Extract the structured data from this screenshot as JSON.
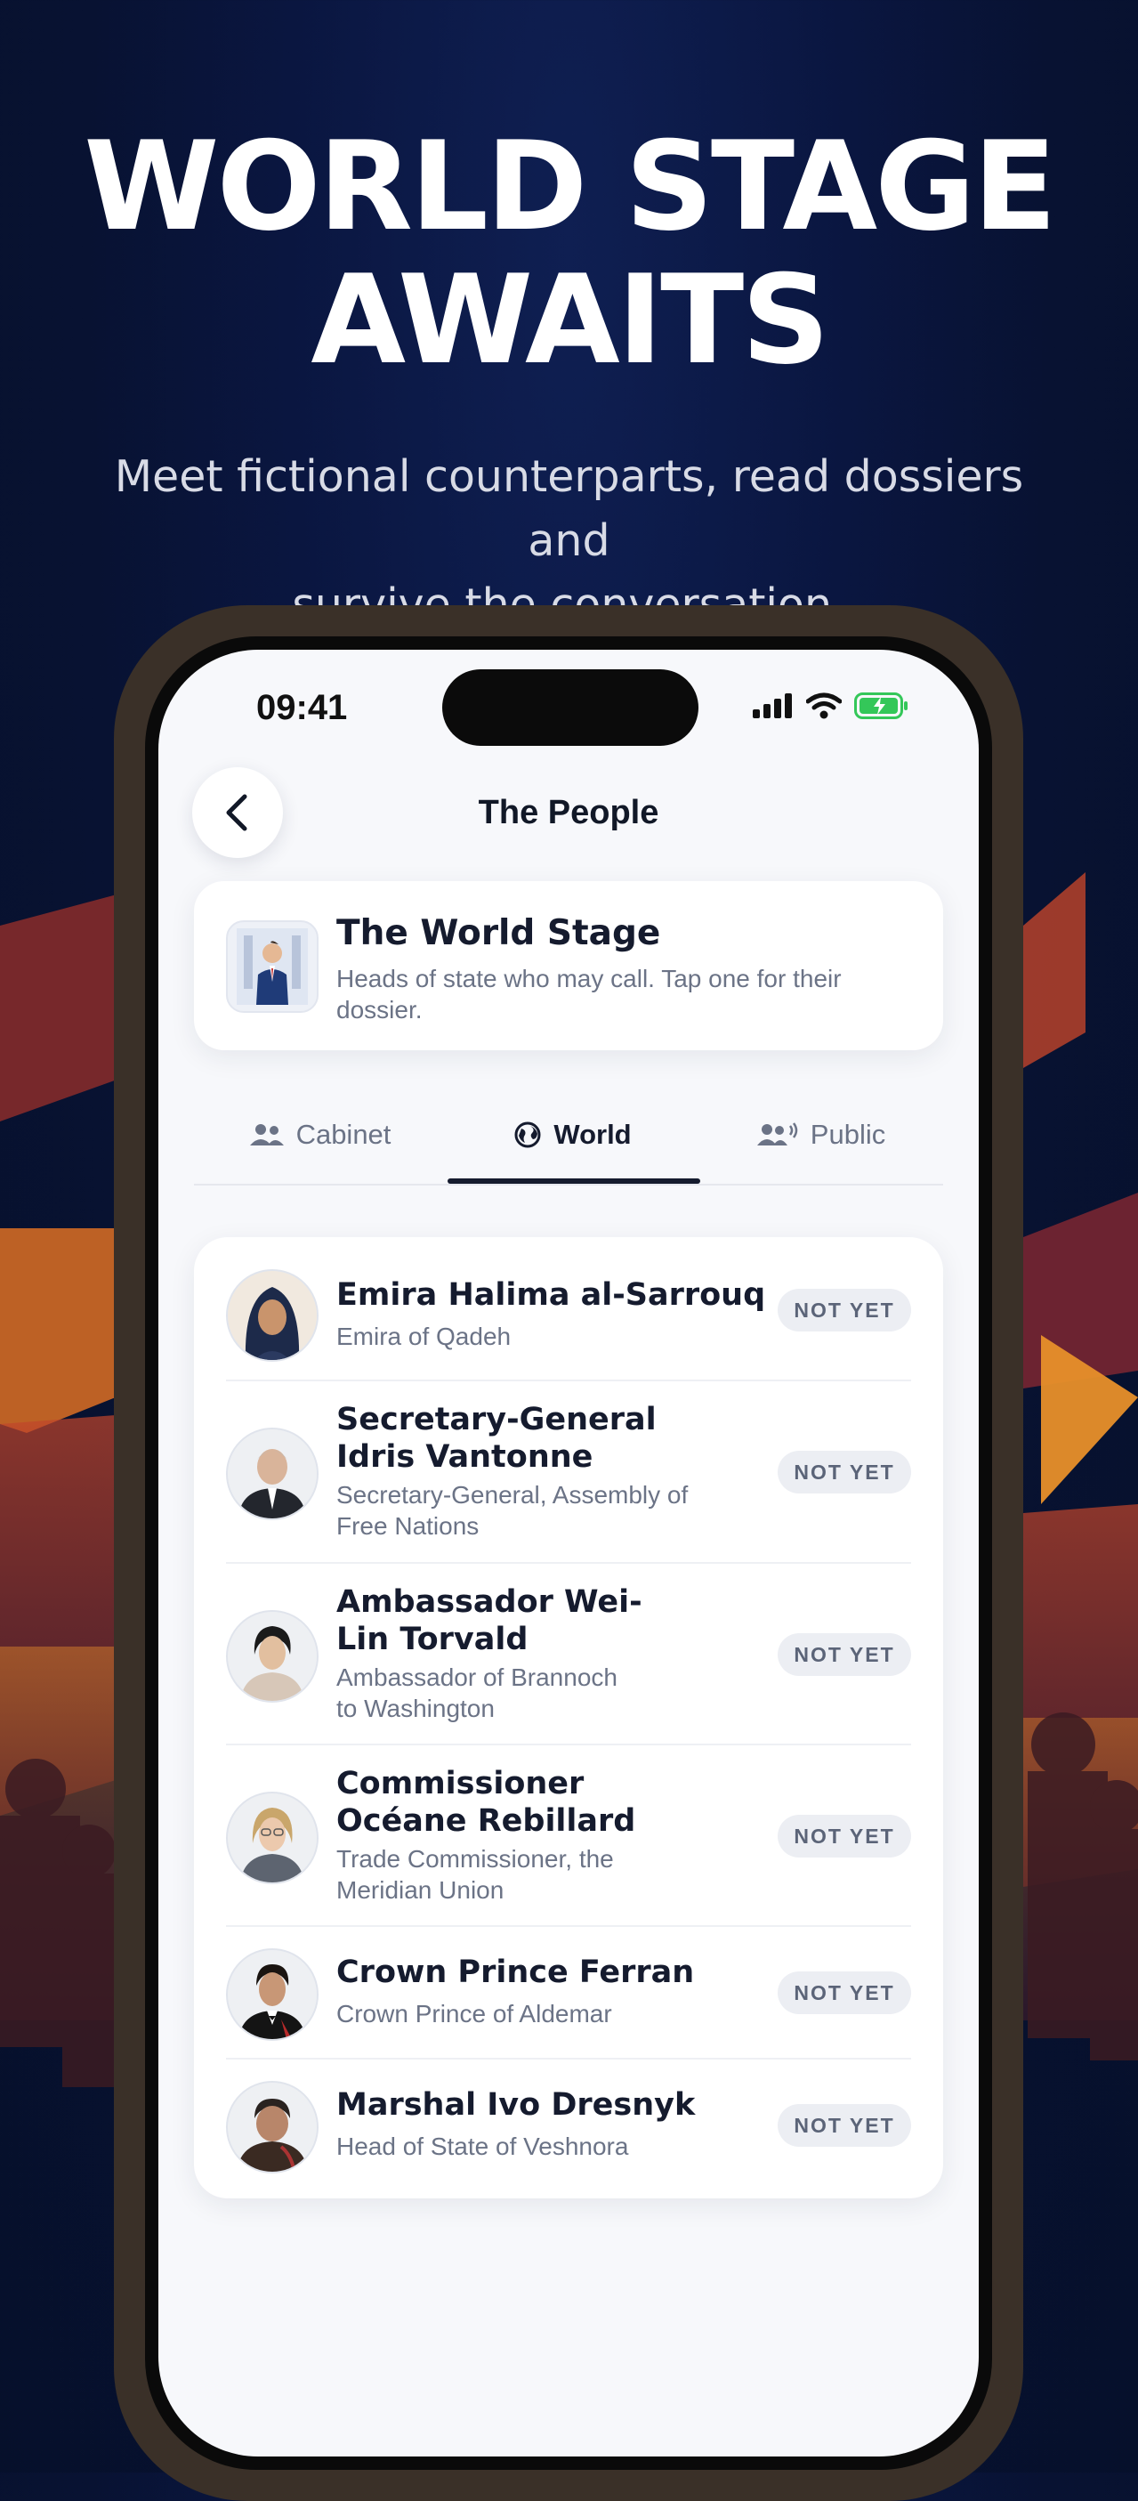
{
  "hero": {
    "title_line1": "WORLD STAGE",
    "title_line2": "AWAITS",
    "subtitle_line1": "Meet fictional counterparts, read dossiers and",
    "subtitle_line2": "survive the conversation."
  },
  "status_bar": {
    "time": "09:41"
  },
  "nav": {
    "title": "The People",
    "back_icon": "chevron-left-icon"
  },
  "info_card": {
    "title": "The World Stage",
    "description": "Heads of state who may call. Tap one for their dossier."
  },
  "tabs": [
    {
      "label": "Cabinet",
      "icon": "people-icon",
      "active": false
    },
    {
      "label": "World",
      "icon": "globe-icon",
      "active": true
    },
    {
      "label": "Public",
      "icon": "people-speaking-icon",
      "active": false
    }
  ],
  "people": [
    {
      "name": "Emira Halima al-Sarrouq",
      "role": "Emira of Qadeh",
      "status": "NOT YET"
    },
    {
      "name_line1": "Secretary-General",
      "name_line2": "Idris Vantonne",
      "role_line1": "Secretary-General, Assembly of",
      "role_line2": "Free Nations",
      "status": "NOT YET"
    },
    {
      "name_line1": "Ambassador Wei-",
      "name_line2": "Lin Torvald",
      "role_line1": "Ambassador of Brannoch",
      "role_line2": "to Washington",
      "status": "NOT YET"
    },
    {
      "name_line1": "Commissioner",
      "name_line2": "Océane Rebillard",
      "role_line1": "Trade Commissioner, the",
      "role_line2": "Meridian Union",
      "status": "NOT YET"
    },
    {
      "name": "Crown Prince Ferran",
      "role": "Crown Prince of Aldemar",
      "status": "NOT YET"
    },
    {
      "name": "Marshal Ivo Dresnyk",
      "role": "Head of State of Veshnora",
      "status": "NOT YET"
    }
  ],
  "colors": {
    "background": "#0a1640",
    "accent": "#151b2e",
    "battery": "#34c759"
  }
}
